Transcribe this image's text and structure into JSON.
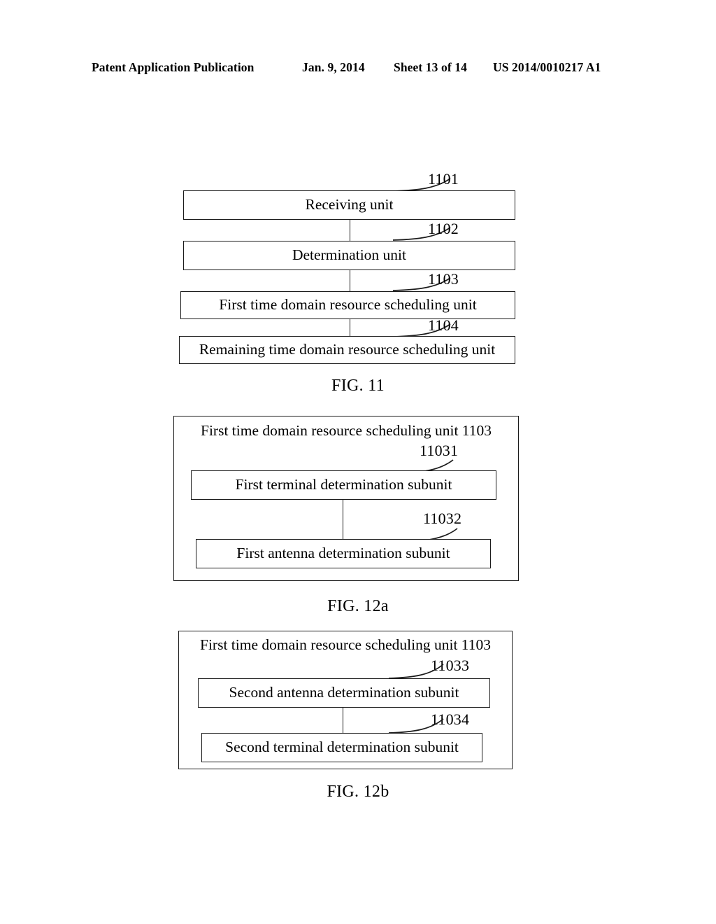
{
  "header": {
    "publication": "Patent Application Publication",
    "date": "Jan. 9, 2014",
    "sheet": "Sheet 13 of 14",
    "patent_number": "US 2014/0010217 A1"
  },
  "figures": [
    {
      "id": "fig11",
      "caption": "FIG. 11",
      "blocks": [
        {
          "ref": "1101",
          "label": "Receiving unit"
        },
        {
          "ref": "1102",
          "label": "Determination unit"
        },
        {
          "ref": "1103",
          "label": "First time domain resource scheduling unit"
        },
        {
          "ref": "1104",
          "label": "Remaining time domain resource scheduling unit"
        }
      ]
    },
    {
      "id": "fig12a",
      "caption": "FIG. 12a",
      "container_label": "First time domain resource scheduling unit 1103",
      "blocks": [
        {
          "ref": "11031",
          "label": "First terminal determination subunit"
        },
        {
          "ref": "11032",
          "label": "First antenna determination subunit"
        }
      ]
    },
    {
      "id": "fig12b",
      "caption": "FIG. 12b",
      "container_label": "First time domain resource scheduling unit 1103",
      "blocks": [
        {
          "ref": "11033",
          "label": "Second antenna determination subunit"
        },
        {
          "ref": "11034",
          "label": "Second terminal determination subunit"
        }
      ]
    }
  ],
  "colors": {
    "ink": "#1b1b1b",
    "page": "#ffffff"
  }
}
